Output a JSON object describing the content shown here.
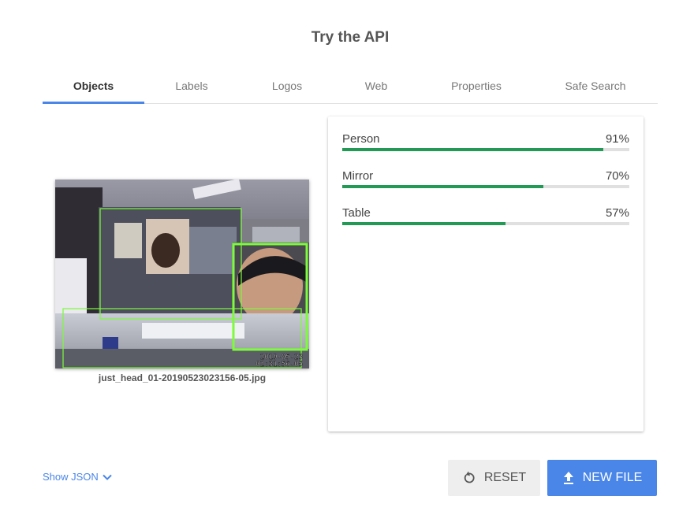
{
  "page": {
    "title": "Try the API"
  },
  "tabs": [
    {
      "label": "Objects",
      "active": true
    },
    {
      "label": "Labels",
      "active": false
    },
    {
      "label": "Logos",
      "active": false
    },
    {
      "label": "Web",
      "active": false
    },
    {
      "label": "Properties",
      "active": false
    },
    {
      "label": "Safe Search",
      "active": false
    }
  ],
  "image": {
    "filename": "just_head_01-20190523023156-05.jpg",
    "timestamp_date": "2019-05-23",
    "timestamp_time": "02:31:56-05"
  },
  "results": [
    {
      "label": "Person",
      "percent_text": "91%",
      "score": 0.91
    },
    {
      "label": "Mirror",
      "percent_text": "70%",
      "score": 0.7
    },
    {
      "label": "Table",
      "percent_text": "57%",
      "score": 0.57
    }
  ],
  "footer": {
    "show_json_label": "Show JSON",
    "reset_label": "RESET",
    "new_file_label": "NEW FILE"
  },
  "colors": {
    "accent": "#4a86e8",
    "bar_fill": "#229954",
    "bar_track": "#e0e0e0",
    "bounding_box": "#7cfc3a"
  },
  "icons": {
    "show_json": "chevron-down-icon",
    "reset": "reset-icon",
    "new_file": "upload-icon"
  }
}
